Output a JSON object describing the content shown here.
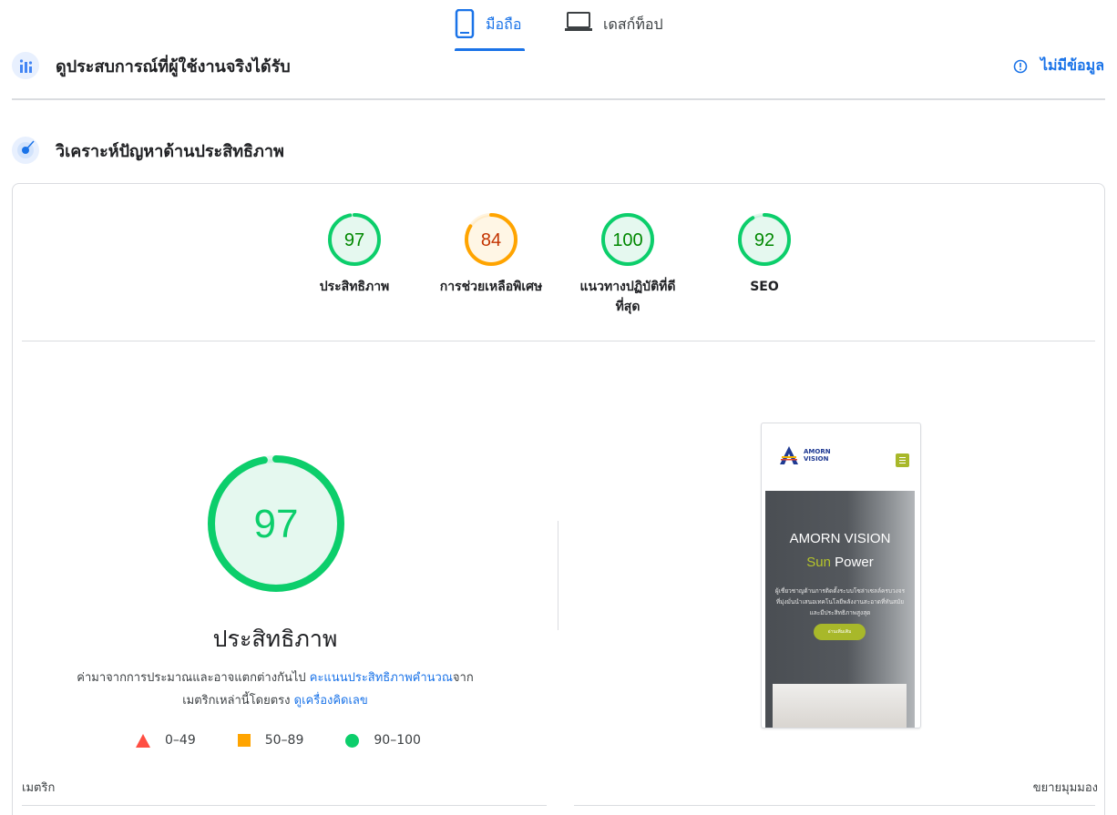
{
  "tabs": {
    "mobile": "มือถือ",
    "desktop": "เดสก์ท็อป"
  },
  "crux": {
    "title": "ดูประสบการณ์ที่ผู้ใช้งานจริงได้รับ",
    "no_data": "ไม่มีข้อมูล"
  },
  "diagnose": {
    "title": "วิเคราะห์ปัญหาด้านประสิทธิภาพ"
  },
  "gauges": [
    {
      "score": 97,
      "label": "ประสิทธิภาพ",
      "status": "pass",
      "color": "#0cce6b",
      "text_color": "#008800",
      "fill": "#e5f8ef"
    },
    {
      "score": 84,
      "label": "การช่วยเหลือพิเศษ",
      "status": "average",
      "color": "#ffa400",
      "text_color": "#c33300",
      "fill": "#fff6e5"
    },
    {
      "score": 100,
      "label_line1": "แนวทางปฏิบัติที่ดี",
      "label_line2": "ที่สุด",
      "status": "pass",
      "color": "#0cce6b",
      "text_color": "#008800",
      "fill": "#e5f8ef"
    },
    {
      "score": 92,
      "label": "SEO",
      "status": "pass",
      "color": "#0cce6b",
      "text_color": "#008800",
      "fill": "#e5f8ef"
    }
  ],
  "main_gauge": {
    "score": 97,
    "title": "ประสิทธิภาพ"
  },
  "description": {
    "part1": "ค่ามาจากการประมาณและอาจแตกต่างกันไป ",
    "link1": "คะแนนประสิทธิภาพคำนวณ",
    "part2": "จาก",
    "part3": "เมตริกเหล่านี้โดยตรง ",
    "link2": "ดูเครื่องคิดเลข"
  },
  "legend": {
    "fail": "0–49",
    "average": "50–89",
    "pass": "90–100"
  },
  "screenshot": {
    "logo_line1": "AMORN",
    "logo_line2": "VISION",
    "headline1": "AMORN VISION",
    "headline2_accent": "Sun",
    "headline2_rest": " Power",
    "paragraph": "ผู้เชี่ยวชาญด้านการติดตั้งระบบโซล่าเซลล์ครบวงจร ที่มุ่งมั่นนำเสนอเทคโนโลยีพลังงานสะอาดที่ทันสมัยและมีประสิทธิภาพสูงสุด",
    "button": "อ่านเพิ่มเติม"
  },
  "footer": {
    "metrics": "เมตริก",
    "expand": "ขยายมุมมอง"
  },
  "colors": {
    "accent": "#1a73e8",
    "pass": "#0cce6b",
    "average": "#ffa400",
    "fail": "#ff4e42"
  }
}
